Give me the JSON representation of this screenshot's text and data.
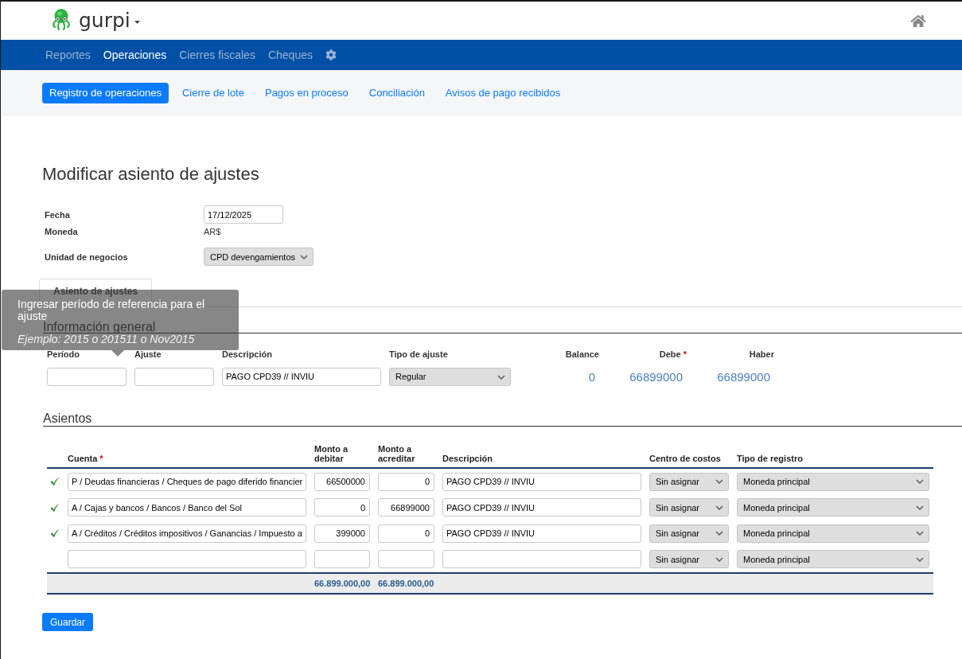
{
  "header": {
    "brand": "gurpi"
  },
  "navbar": {
    "items": [
      {
        "label": "Reportes",
        "selected": false
      },
      {
        "label": "Operaciones",
        "selected": true
      },
      {
        "label": "Cierres fiscales",
        "selected": false
      },
      {
        "label": "Cheques",
        "selected": false
      }
    ]
  },
  "subnav": {
    "items": [
      {
        "label": "Registro de operaciones",
        "selected": true
      },
      {
        "label": "Cierre de lote",
        "selected": false
      },
      {
        "label": "Pagos en proceso",
        "selected": false
      },
      {
        "label": "Conciliación",
        "selected": false
      },
      {
        "label": "Avisos de pago recibidos",
        "selected": false
      }
    ]
  },
  "page_title": "Modificar asiento de ajustes",
  "form": {
    "fields": [
      {
        "kind": "input",
        "label": "Fecha",
        "value": "17/12/2025"
      },
      {
        "kind": "text",
        "label": "Moneda",
        "value": "AR$"
      },
      {
        "kind": "select",
        "label": "Unidad de negocios",
        "value": "CPD devengamientos"
      }
    ]
  },
  "tabs": [
    {
      "label": "Asiento de ajustes",
      "selected": true
    }
  ],
  "tooltip": {
    "text": "Ingresar período de referencia para el ajuste",
    "example": "Ejemplo: 2015 o 201511 o Nov2015"
  },
  "general_info": {
    "title": "Información general",
    "fields": [
      {
        "kind": "input",
        "label": "Período"
      },
      {
        "kind": "input",
        "label": "Ajuste"
      },
      {
        "kind": "input",
        "label": "Descripción",
        "value": "PAGO CPD39 // INVIU"
      },
      {
        "kind": "select",
        "label": "Tipo de ajuste",
        "value": "Regular"
      },
      {
        "kind": "amount",
        "label": "Balance",
        "value": "0"
      },
      {
        "kind": "amount",
        "label": "Debe",
        "required_mark": "*",
        "value": "66899000"
      },
      {
        "kind": "amount",
        "label": "Haber",
        "value": "66899000"
      }
    ]
  },
  "entries": {
    "title": "Asientos",
    "columns": [
      {
        "label": "Cuenta",
        "required_mark": "*"
      },
      {
        "label": "Monto a debitar"
      },
      {
        "label": "Monto a acreditar"
      },
      {
        "label": "Descripción"
      },
      {
        "label": "Centro de costos"
      },
      {
        "label": "Tipo de registro"
      }
    ],
    "rows": [
      {
        "valid": true,
        "cells": [
          {
            "kind": "input",
            "value": "P / Deudas financieras / Cheques de pago diferido financier"
          },
          {
            "kind": "number",
            "value": "66500000"
          },
          {
            "kind": "number",
            "value": "0"
          },
          {
            "kind": "input",
            "value": "PAGO CPD39 // INVIU"
          },
          {
            "kind": "select",
            "value": "Sin asignar"
          },
          {
            "kind": "select",
            "value": "Moneda principal"
          }
        ]
      },
      {
        "valid": true,
        "cells": [
          {
            "kind": "input",
            "value": "A / Cajas y bancos / Bancos / Banco del Sol"
          },
          {
            "kind": "number",
            "value": "0"
          },
          {
            "kind": "number",
            "value": "66899000"
          },
          {
            "kind": "input",
            "value": "PAGO CPD39 // INVIU"
          },
          {
            "kind": "select",
            "value": "Sin asignar"
          },
          {
            "kind": "select",
            "value": "Moneda principal"
          }
        ]
      },
      {
        "valid": true,
        "cells": [
          {
            "kind": "input",
            "value": "A / Créditos / Créditos impositivos / Ganancias / Impuesto a"
          },
          {
            "kind": "number",
            "value": "399000"
          },
          {
            "kind": "number",
            "value": "0"
          },
          {
            "kind": "input",
            "value": "PAGO CPD39 // INVIU"
          },
          {
            "kind": "select",
            "value": "Sin asignar"
          },
          {
            "kind": "select",
            "value": "Moneda principal"
          }
        ]
      },
      {
        "valid": false,
        "cells": [
          {
            "kind": "input"
          },
          {
            "kind": "number"
          },
          {
            "kind": "number"
          },
          {
            "kind": "input"
          },
          {
            "kind": "select",
            "value": "Sin asignar"
          },
          {
            "kind": "select",
            "value": "Moneda principal"
          }
        ]
      }
    ],
    "totals": {
      "debit": "66.899.000,00",
      "credit": "66.899.000,00"
    }
  },
  "save_button": "Guardar"
}
